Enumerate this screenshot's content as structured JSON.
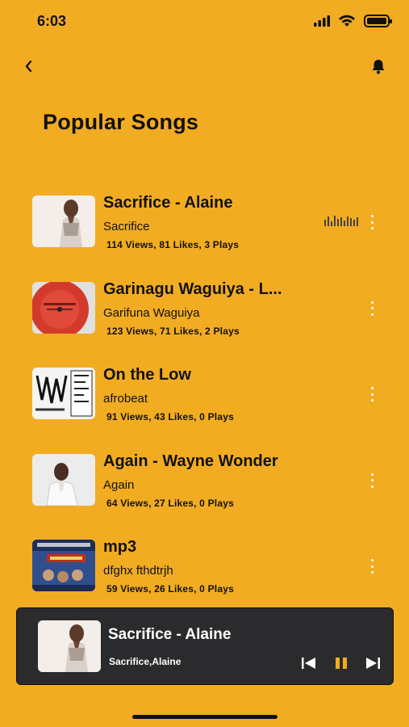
{
  "status_bar": {
    "time": "6:03"
  },
  "header": {
    "title": "Popular Songs",
    "back_icon": "chevron-left-icon",
    "bell_icon": "bell-icon"
  },
  "songs": [
    {
      "title": "Sacrifice - Alaine",
      "album": "Sacrifice",
      "stats": "114 Views, 81 Likes, 3 Plays",
      "playing": true
    },
    {
      "title": "Garinagu Waguiya - L...",
      "album": "Garifuna Waguiya",
      "stats": "123 Views, 71 Likes, 2 Plays",
      "playing": false
    },
    {
      "title": "On the Low",
      "album": "afrobeat",
      "stats": "91 Views, 43 Likes, 0 Plays",
      "playing": false
    },
    {
      "title": "Again - Wayne Wonder",
      "album": "Again",
      "stats": "64 Views, 27 Likes, 0 Plays",
      "playing": false
    },
    {
      "title": "mp3",
      "album": "dfghx fthdtrjh",
      "stats": "59 Views, 26 Likes, 0 Plays",
      "playing": false
    }
  ],
  "now_playing": {
    "title": "Sacrifice - Alaine",
    "subtitle": "Sacrifice,Alaine"
  },
  "colors": {
    "background": "#F2AC22",
    "player_bg": "#2B2B2D",
    "pause_accent": "#F2AC22"
  }
}
